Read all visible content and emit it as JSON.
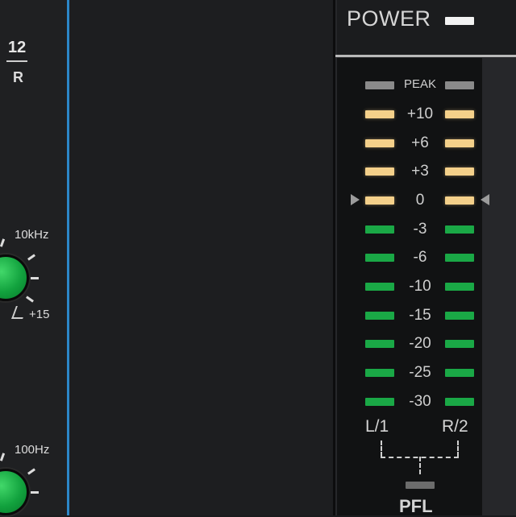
{
  "channel": {
    "number": "12",
    "side": "R"
  },
  "eq": {
    "high_freq": "10kHz",
    "high_gain": "+15",
    "low_freq": "100Hz"
  },
  "power": {
    "label": "POWER",
    "led_color": "#f2f2f2"
  },
  "meter": {
    "peak_label": "PEAK",
    "levels": [
      "+10",
      "+6",
      "+3",
      "0",
      "-3",
      "-6",
      "-10",
      "-15",
      "-20",
      "-25",
      "-30"
    ],
    "left_label": "L/1",
    "right_label": "R/2",
    "amber_color": "#f4d08a",
    "green_color": "#1aa846",
    "peak_color": "#8a8a8a"
  },
  "pfl": {
    "label": "PFL"
  },
  "accent_color": "#2b86c8"
}
